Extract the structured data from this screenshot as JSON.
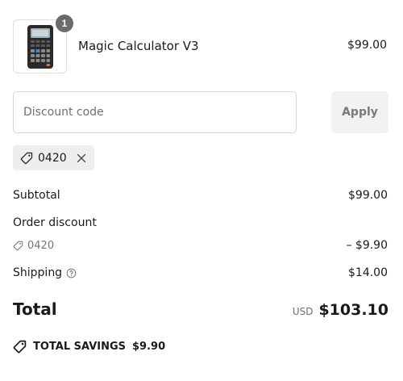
{
  "cart": {
    "item": {
      "quantity": "1",
      "name": "Magic Calculator V3",
      "price": "$99.00",
      "thumbnail_icon": "calculator-image"
    }
  },
  "discount": {
    "placeholder": "Discount code",
    "apply_label": "Apply",
    "applied_code": "0420"
  },
  "summary": {
    "subtotal_label": "Subtotal",
    "subtotal_value": "$99.00",
    "order_discount_label": "Order discount",
    "order_discount_code": "0420",
    "order_discount_value": "– $9.90",
    "shipping_label": "Shipping",
    "shipping_value": "$14.00",
    "total_label": "Total",
    "currency": "USD",
    "total_value": "$103.10",
    "savings_label": "TOTAL SAVINGS",
    "savings_value": "$9.90"
  },
  "colors": {
    "badge": "#6b6b6b",
    "chip_bg": "#eeeeee",
    "apply_bg": "#f2f2f2"
  }
}
